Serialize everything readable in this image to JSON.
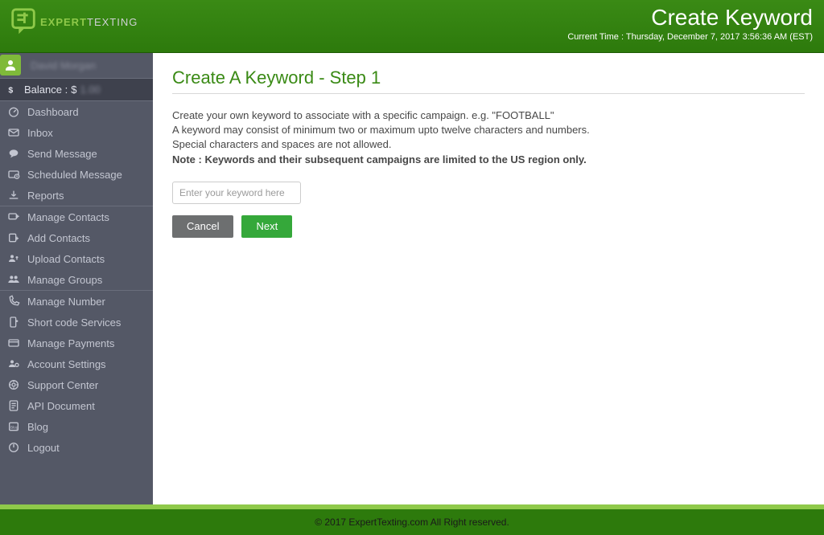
{
  "header": {
    "page_title": "Create Keyword",
    "current_time_label": "Current Time : Thursday, December 7, 2017 3:56:36 AM (EST)",
    "logo_text_1": "EXPERT",
    "logo_text_2": "TEXTING"
  },
  "sidebar": {
    "user_name": "David Morgan",
    "balance_label": "Balance :",
    "balance_currency": "$",
    "balance_value": "1.00",
    "groups": [
      {
        "id": "main",
        "items": [
          {
            "icon": "gauge",
            "label": "Dashboard"
          },
          {
            "icon": "envelope",
            "label": "Inbox"
          },
          {
            "icon": "chat",
            "label": "Send Message"
          },
          {
            "icon": "clock-mail",
            "label": "Scheduled Message"
          },
          {
            "icon": "download",
            "label": "Reports"
          }
        ]
      },
      {
        "id": "contacts",
        "items": [
          {
            "icon": "card-plus",
            "label": "Manage Contacts"
          },
          {
            "icon": "add-card",
            "label": "Add Contacts"
          },
          {
            "icon": "upload-user",
            "label": "Upload Contacts"
          },
          {
            "icon": "group",
            "label": "Manage Groups"
          }
        ]
      },
      {
        "id": "settings",
        "items": [
          {
            "icon": "phone",
            "label": "Manage Number"
          },
          {
            "icon": "shortcode",
            "label": "Short code Services"
          },
          {
            "icon": "credit-card",
            "label": "Manage Payments"
          },
          {
            "icon": "gear-user",
            "label": "Account Settings"
          },
          {
            "icon": "support",
            "label": "Support Center"
          },
          {
            "icon": "doc",
            "label": "API Document"
          },
          {
            "icon": "blog",
            "label": "Blog"
          },
          {
            "icon": "power",
            "label": "Logout"
          }
        ]
      }
    ]
  },
  "main": {
    "title": "Create A Keyword - Step 1",
    "desc_line_1": "Create your own keyword to associate with a specific campaign. e.g. \"FOOTBALL\"",
    "desc_line_2": "A keyword may consist of minimum two or maximum upto twelve characters and numbers.",
    "desc_line_3": "Special characters and spaces are not allowed.",
    "desc_note": "Note : Keywords and their subsequent campaigns are limited to the US region only.",
    "keyword_placeholder": "Enter your keyword here",
    "keyword_value": "",
    "cancel_label": "Cancel",
    "next_label": "Next"
  },
  "footer": {
    "text": "© 2017 ExpertTexting.com All Right reserved."
  }
}
